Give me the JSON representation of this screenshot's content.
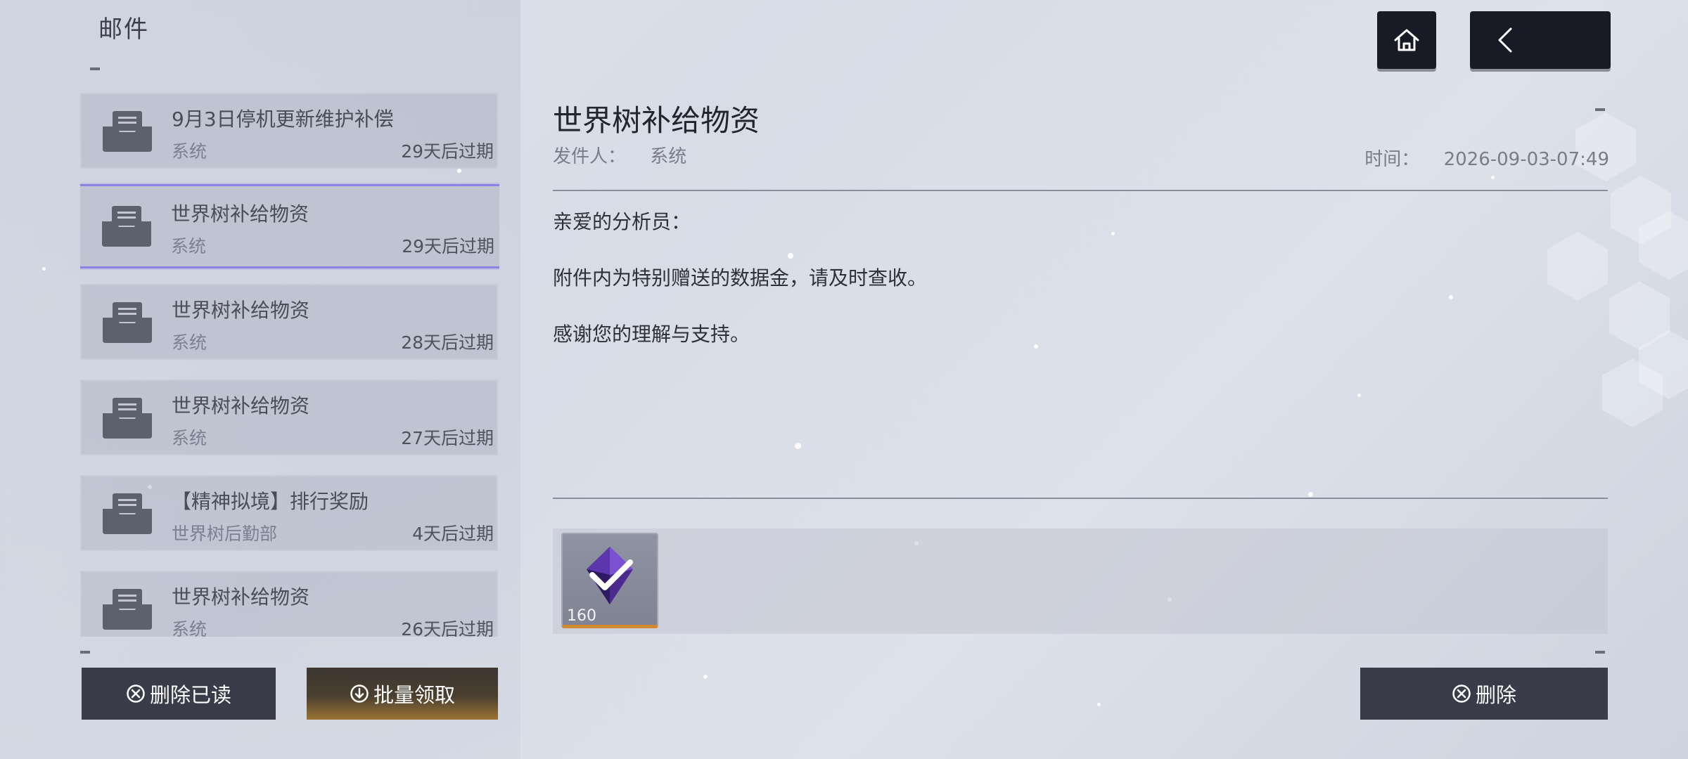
{
  "header": {
    "title": "邮件"
  },
  "mail_list": [
    {
      "title": "9月3日停机更新维护补偿",
      "sender": "系统",
      "expire": "29天后过期",
      "selected": false
    },
    {
      "title": "世界树补给物资",
      "sender": "系统",
      "expire": "29天后过期",
      "selected": true
    },
    {
      "title": "世界树补给物资",
      "sender": "系统",
      "expire": "28天后过期",
      "selected": false
    },
    {
      "title": "世界树补给物资",
      "sender": "系统",
      "expire": "27天后过期",
      "selected": false
    },
    {
      "title": "【精神拟境】排行奖励",
      "sender": "世界树后勤部",
      "expire": "4天后过期",
      "selected": false
    },
    {
      "title": "世界树补给物资",
      "sender": "系统",
      "expire": "26天后过期",
      "selected": false
    }
  ],
  "buttons": {
    "delete_read": "删除已读",
    "batch_claim": "批量领取",
    "delete": "删除"
  },
  "detail": {
    "title": "世界树补给物资",
    "sender_label": "发件人：",
    "sender": "系统",
    "time_label": "时间：",
    "time": "2026-09-03-07:49",
    "body": [
      "亲爱的分析员：",
      "附件内为特别赠送的数据金，请及时查收。",
      "感谢您的理解与支持。"
    ],
    "attachments": [
      {
        "icon": "purple-crystal-icon",
        "count": "160"
      }
    ]
  },
  "icons": {
    "home": "home-icon",
    "back": "back-arrow-icon",
    "mail": "mail-tray-icon",
    "delete": "circle-x-icon",
    "claim": "circle-down-icon"
  },
  "colors": {
    "selected_border": "#8c82e6",
    "button_dark": "#3a3b48",
    "claim_gold": "#9c7434",
    "attachment_underline": "#d08b2f"
  }
}
